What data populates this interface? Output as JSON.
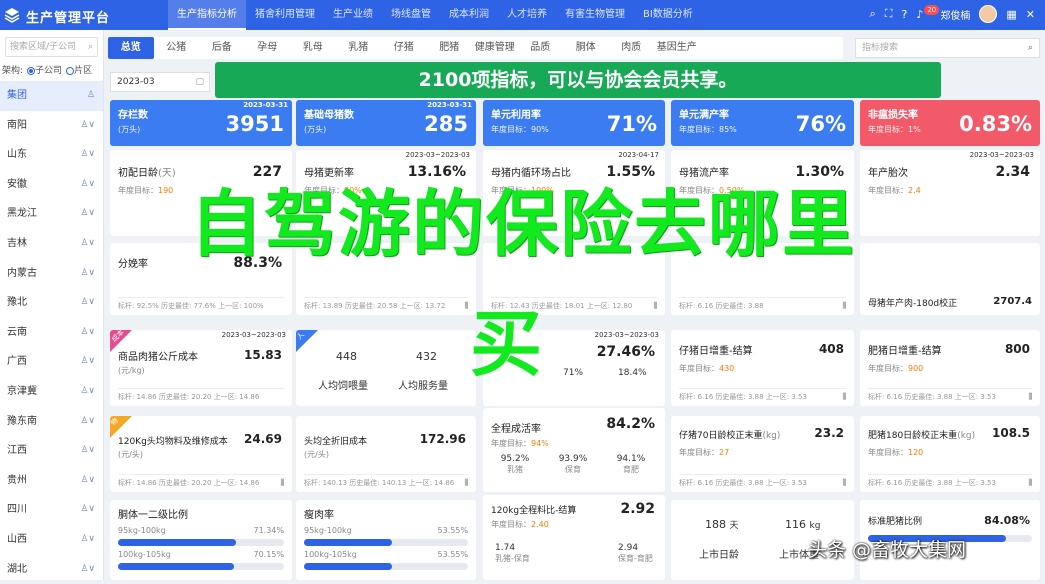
{
  "app": {
    "title": "生产管理平台"
  },
  "nav": [
    "生产指标分析",
    "猪舍利用管理",
    "生产业绩",
    "场线盘管",
    "成本利润",
    "人才培养",
    "有害生物管理",
    "BI数据分析"
  ],
  "topbar": {
    "notif_count": "20",
    "user": "郑俊楠"
  },
  "sidebar": {
    "search_placeholder": "搜索区域/子公司",
    "radio_label": "架构:",
    "radio_options": [
      "子公司",
      "片区"
    ],
    "items": [
      {
        "label": "集团",
        "icon": "person-icon",
        "glyph": "♙"
      },
      {
        "label": "南阳",
        "icon": "person-chevron-icon",
        "glyph": "♙∨"
      },
      {
        "label": "山东",
        "icon": "person-chevron-icon",
        "glyph": "♙∨"
      },
      {
        "label": "安徽",
        "icon": "person-chevron-icon",
        "glyph": "♙∨"
      },
      {
        "label": "黑龙江",
        "icon": "person-chevron-icon",
        "glyph": "♙∨"
      },
      {
        "label": "吉林",
        "icon": "person-chevron-icon",
        "glyph": "♙∨"
      },
      {
        "label": "内蒙古",
        "icon": "person-chevron-icon",
        "glyph": "♙∨"
      },
      {
        "label": "豫北",
        "icon": "person-chevron-icon",
        "glyph": "♙∨"
      },
      {
        "label": "云南",
        "icon": "person-chevron-icon",
        "glyph": "♙∨"
      },
      {
        "label": "广西",
        "icon": "person-chevron-icon",
        "glyph": "♙∨"
      },
      {
        "label": "京津冀",
        "icon": "person-chevron-icon",
        "glyph": "♙∨"
      },
      {
        "label": "豫东南",
        "icon": "person-chevron-icon",
        "glyph": "♙∨"
      },
      {
        "label": "江西",
        "icon": "person-chevron-icon",
        "glyph": "♙∨"
      },
      {
        "label": "贵州",
        "icon": "person-chevron-icon",
        "glyph": "♙∨"
      },
      {
        "label": "四川",
        "icon": "person-chevron-icon",
        "glyph": "♙∨"
      },
      {
        "label": "山西",
        "icon": "person-chevron-icon",
        "glyph": "♙∨"
      },
      {
        "label": "湖北",
        "icon": "person-chevron-icon",
        "glyph": "♙∨"
      }
    ]
  },
  "tabs": [
    "总览",
    "公猪",
    "后备",
    "孕母",
    "乳母",
    "乳猪",
    "仔猪",
    "肥猪",
    "健康管理",
    "品质",
    "胴体",
    "肉质",
    "基因生产力"
  ],
  "indicator_search": "指标搜索",
  "date": "2023-03",
  "banner": "2100项指标，可以与协会会员共享。",
  "colors": {
    "primary": "#2f63e6",
    "summary_blue": "#3b7cf3",
    "summary_red": "#f25a6a",
    "green": "#18a957",
    "overlay": "#13e91f"
  },
  "summary_cards": [
    {
      "name": "存栏数",
      "sub": "(万头)",
      "date": "2023-03-31",
      "value": "3951",
      "color": "#3b7cf3"
    },
    {
      "name": "基础母猪数",
      "sub": "(万头)",
      "date": "2023-03-31",
      "value": "285",
      "color": "#3b7cf3"
    },
    {
      "name": "单元利用率",
      "sub": "年度目标：90%",
      "date": "",
      "value": "71%",
      "color": "#3b7cf3"
    },
    {
      "name": "单元满产率",
      "sub": "年度目标：85%",
      "date": "",
      "value": "76%",
      "color": "#3b7cf3"
    },
    {
      "name": "非瘟损失率",
      "sub": "年度目标：1%",
      "date": "",
      "value": "0.83%",
      "color": "#f25a6a"
    }
  ],
  "row1": [
    {
      "name": "初配日龄",
      "unit": "(天)",
      "date": "",
      "value": "227",
      "target_label": "年度目标：",
      "target": "190"
    },
    {
      "name": "母猪更新率",
      "unit": "",
      "date": "2023-03~2023-03",
      "value": "13.16%",
      "target_label": "年度目标：",
      "target": "90%"
    },
    {
      "name": "母猪内循环场占比",
      "unit": "",
      "date": "2023-04-17",
      "value": "1.55%",
      "target_label": "年度目标：",
      "target": "100%"
    },
    {
      "name": "母猪流产率",
      "unit": "",
      "date": "",
      "value": "1.30%",
      "target_label": "年度目标：",
      "target": "0.50%"
    },
    {
      "name": "年产胎次",
      "unit": "",
      "date": "2023-03~2023-03",
      "value": "2.34",
      "target_label": "年度目标：",
      "target": "2.4"
    }
  ],
  "row2": [
    {
      "name": "分娩率",
      "value": "88.3%",
      "foot": "标杆: 92.5% 历史最佳: 77.6% 上一区: 100%"
    },
    {
      "name": "",
      "value": "",
      "foot": "标杆: 13.89 历史最佳: 20.58 上一区: 13.72"
    },
    {
      "name": "",
      "value": "",
      "foot": "标杆: 12.43 历史最佳: 18.01 上一区: 12.80"
    },
    {
      "name": "",
      "value": "",
      "foot": "标杆: 6.16 历史最佳: 3.88"
    },
    {
      "name": "母猪年产肉-180d校正",
      "value": "2707.4",
      "foot": ""
    }
  ],
  "row3": {
    "c1": {
      "corner": "成本",
      "name": "商品肉猪公斤成本",
      "unit": "(元/kg)",
      "date": "2023-03~2023-03",
      "value": "15.83",
      "foot": "标杆: 14.86 历史最佳: 20.20 上一区: 14.86"
    },
    "c2": {
      "corner": "人",
      "items": [
        {
          "v": "448",
          "l": "人均饲喂量"
        },
        {
          "v": "432",
          "l": "人均服务量"
        }
      ]
    },
    "c3": {
      "date": "2023-03~2023-03",
      "value": "27.46%",
      "sub": [
        {
          "v": "71%",
          "l": ""
        },
        {
          "v": "18.4%",
          "l": ""
        }
      ]
    },
    "c4": {
      "name": "仔猪日增重-结算",
      "value": "408",
      "target_label": "年度目标：",
      "target": "430",
      "foot": "标杆: 6.16 历史最佳: 3.88 上一区: 3.53"
    },
    "c5": {
      "name": "肥猪日增重-结算",
      "value": "800",
      "target_label": "年度目标：",
      "target": "900",
      "foot": "标杆: 6.16 历史最佳: 3.88 上一区: 3.53"
    }
  },
  "row4": {
    "c1": {
      "corner": "物",
      "name": "120Kg头均物料及维修成本",
      "unit": "(元/头)",
      "value": "24.69",
      "foot": "标杆: 14.86 历史最佳: 20.20 上一区: 14.86"
    },
    "c2": {
      "name": "头均全折旧成本",
      "unit": "(元/头)",
      "value": "172.96",
      "foot": "标杆: 140.13 历史最佳: 140.13 上一区: 14.86"
    },
    "c3": {
      "name": "全程成活率",
      "target_label": "年度目标：",
      "target": "94%",
      "value": "84.2%",
      "sub": [
        {
          "v": "95.2%",
          "l": "乳猪"
        },
        {
          "v": "93.9%",
          "l": "保育"
        },
        {
          "v": "94.1%",
          "l": "育肥"
        }
      ]
    },
    "c4": {
      "name": "仔猪70日龄校正末重",
      "unit": "(kg)",
      "value": "23.2",
      "target_label": "年度目标：",
      "target": "27",
      "foot": "标杆: 6.16 历史最佳: 3.88 上一区: 3.53"
    },
    "c5": {
      "name": "肥猪180日龄校正末重",
      "unit": "(kg)",
      "value": "108.5",
      "target_label": "年度目标：",
      "target": "120",
      "foot": "标杆: 6.16 历史最佳: 3.88 上一区: 3.53"
    }
  },
  "row5": {
    "c1": {
      "name": "胴体一二级比例",
      "bars": [
        {
          "label": "95kg-100kg",
          "pct": "71.34%",
          "frac": 0.7134
        },
        {
          "label": "100kg-105kg",
          "pct": "70.15%",
          "frac": 0.7015
        }
      ]
    },
    "c2": {
      "name": "瘦肉率",
      "bars": [
        {
          "label": "95kg-100kg",
          "pct": "53.55%",
          "frac": 0.5355
        },
        {
          "label": "100kg-105kg",
          "pct": "53.55%",
          "frac": 0.5355
        }
      ]
    },
    "c3": {
      "name": "120kg全程料比-结算",
      "value": "2.92",
      "target_label": "年度目标：",
      "target": "2.40",
      "sub": [
        {
          "v": "1.74",
          "l": "乳猪-保育"
        },
        {
          "v": "2.94",
          "l": "保育-育肥"
        }
      ]
    },
    "c4": {
      "items": [
        {
          "v": "188",
          "u": "天",
          "l": "上市日龄"
        },
        {
          "v": "116",
          "u": "kg",
          "l": "上市体重"
        }
      ]
    },
    "c5": {
      "name": "标准肥猪比例",
      "value": "84.08%",
      "frac": 0.8408
    }
  },
  "overlay": {
    "line1": "自驾游的保险去哪里",
    "line2": "买"
  },
  "watermark": "头条 @畜牧大集网"
}
